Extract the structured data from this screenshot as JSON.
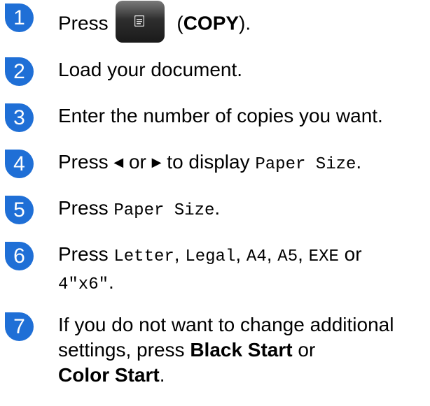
{
  "steps": [
    {
      "number": "1",
      "t1": "Press",
      "t2": " (",
      "t3": "COPY",
      "t4": ")."
    },
    {
      "number": "2",
      "text": "Load your document."
    },
    {
      "number": "3",
      "text": "Enter the number of copies you want."
    },
    {
      "number": "4",
      "t1": "Press ",
      "left_arrow": "◀",
      "t2": " or ",
      "right_arrow": "▶",
      "t3": " to display ",
      "code": "Paper Size",
      "t4": "."
    },
    {
      "number": "5",
      "t1": "Press ",
      "code": "Paper Size",
      "t2": "."
    },
    {
      "number": "6",
      "t1": "Press ",
      "c1": "Letter",
      "s1": ", ",
      "c2": "Legal",
      "s2": ", ",
      "c3": "A4",
      "s3": ", ",
      "c4": "A5",
      "s4": ", ",
      "c5": "EXE",
      "s5": " or ",
      "c6": "4\"x6\"",
      "end": "."
    },
    {
      "number": "7",
      "t1": "If you do not want to change additional settings, press ",
      "b1": "Black Start",
      "t2": " or ",
      "b2": "Color Start",
      "t3": "."
    }
  ],
  "copy_button": {
    "icon": "copy-document-icon"
  }
}
